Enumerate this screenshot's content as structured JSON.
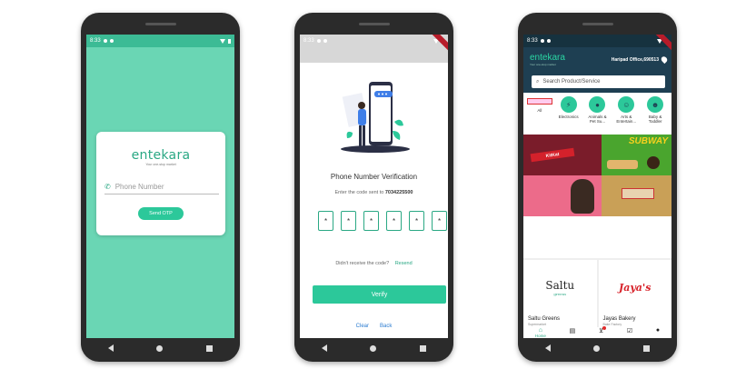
{
  "statusbar": {
    "time": "8:33"
  },
  "login": {
    "brand": "entekara",
    "tagline": "Your one-stop market",
    "phone_placeholder": "Phone Number",
    "send_otp": "Send OTP"
  },
  "verify": {
    "title": "Phone Number Verification",
    "subtitle_prefix": "Enter the code sent to",
    "phone_number": "7034225500",
    "otp_digits": [
      "*",
      "*",
      "*",
      "*",
      "*",
      "*"
    ],
    "resend_question": "Didn't receive the code?",
    "resend_link": "Resend",
    "verify_button": "Verify",
    "clear": "Clear",
    "back": "Back"
  },
  "home": {
    "brand": "entekara",
    "tagline": "Your one-stop market",
    "location": "Haripad Office,690513",
    "search_placeholder": "Search Product/Service",
    "categories": [
      {
        "label": "All",
        "icon": "all-banner"
      },
      {
        "label": "Electronics",
        "icon": "plug-icon"
      },
      {
        "label": "Animals & Pet Su...",
        "icon": "paw-icon"
      },
      {
        "label": "Arts & Entertain...",
        "icon": "masks-icon"
      },
      {
        "label": "Baby & Toddler",
        "icon": "baby-icon"
      }
    ],
    "banners": {
      "kitkat_text": "KitKat",
      "subway_text": "SUBWAY"
    },
    "shops": [
      {
        "name": "Saltu Greens",
        "kind": "Supermarket",
        "logo": "Saltu",
        "logo_sub": "greens"
      },
      {
        "name": "Jayas Bakery",
        "kind": "Bake Factory",
        "logo": "Jaya's"
      }
    ],
    "tabs": [
      {
        "label": "Home",
        "icon": "home-icon"
      },
      {
        "icon": "store-icon"
      },
      {
        "icon": "cart-icon"
      },
      {
        "icon": "orders-icon"
      },
      {
        "icon": "profile-icon"
      }
    ]
  },
  "colors": {
    "brand_green": "#2cc89a",
    "login_bg": "#6ad6b4",
    "header_navy": "#1e3f52"
  }
}
